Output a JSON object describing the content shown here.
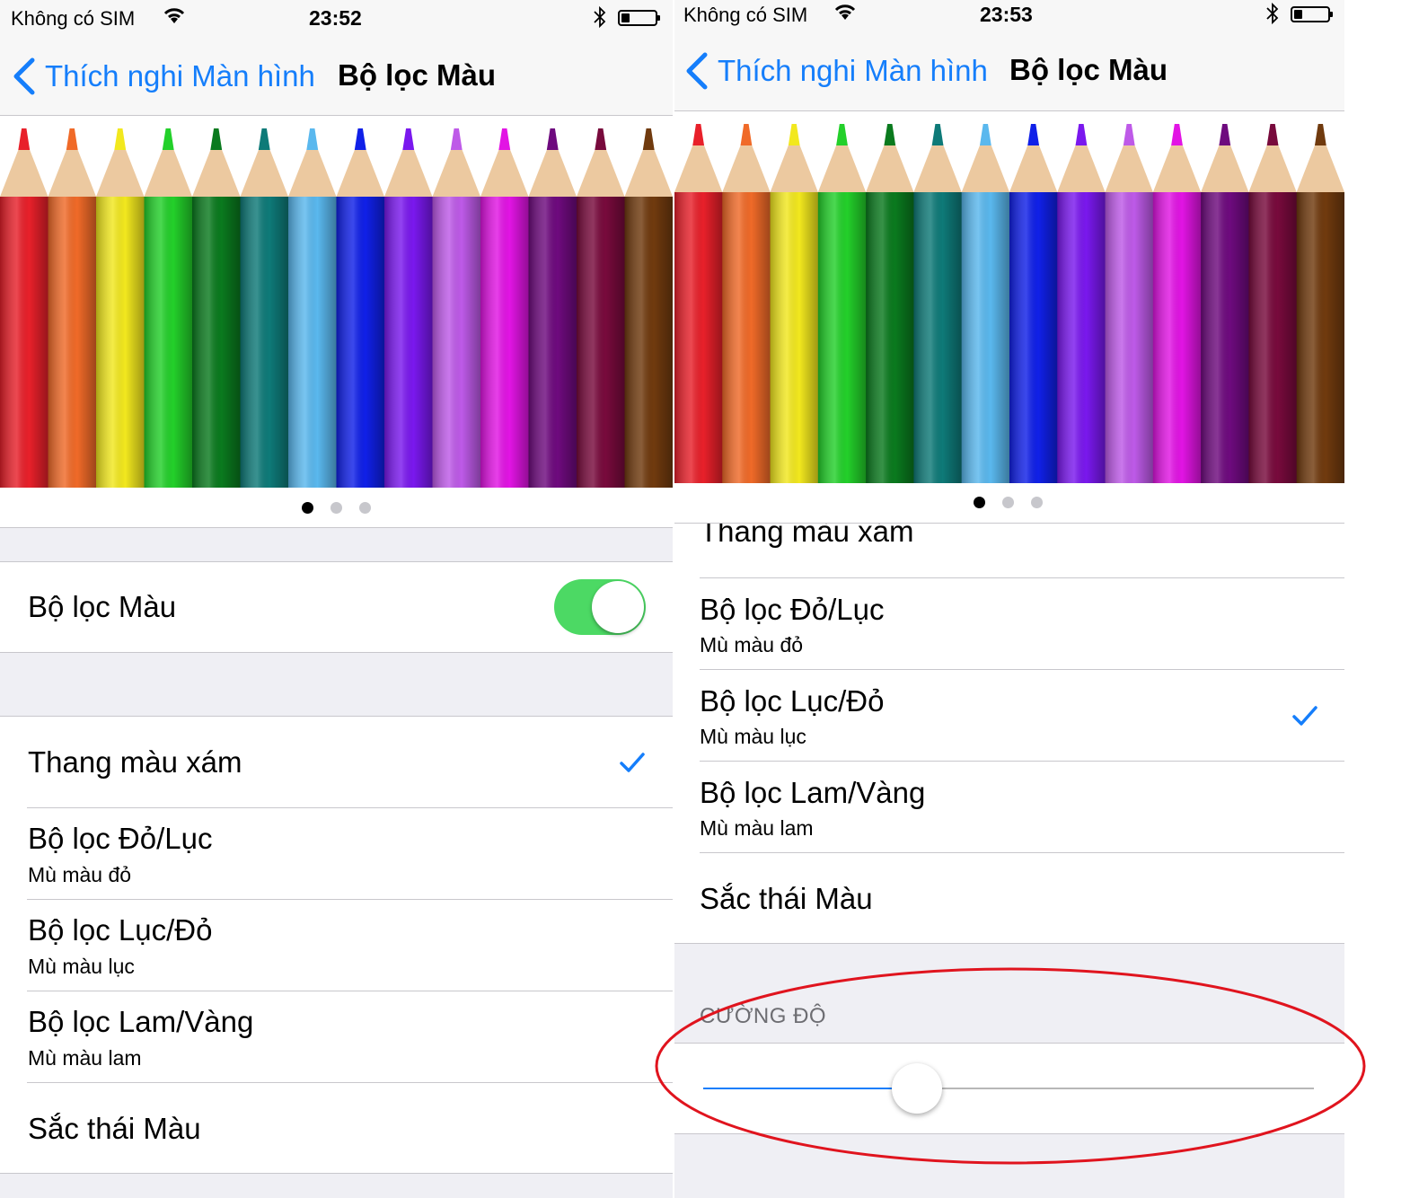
{
  "colors": {
    "accent": "#157efb",
    "switch_on": "#4cd964",
    "annotation": "#e0141e"
  },
  "left": {
    "status": {
      "carrier": "Không có SIM",
      "time": "23:52"
    },
    "nav": {
      "back": "Thích nghi Màn hình",
      "title": "Bộ lọc Màu"
    },
    "pager": {
      "count": 3,
      "active": 1
    },
    "toggle": {
      "label": "Bộ lọc Màu",
      "on": true
    },
    "filters": [
      {
        "title": "Thang màu xám",
        "subtitle": "",
        "checked": true
      },
      {
        "title": "Bộ lọc Đỏ/Lục",
        "subtitle": "Mù màu đỏ",
        "checked": false
      },
      {
        "title": "Bộ lọc Lục/Đỏ",
        "subtitle": "Mù màu lục",
        "checked": false
      },
      {
        "title": "Bộ lọc Lam/Vàng",
        "subtitle": "Mù màu lam",
        "checked": false
      },
      {
        "title": "Sắc thái Màu",
        "subtitle": "",
        "checked": false
      }
    ]
  },
  "right": {
    "status": {
      "carrier": "Không có SIM",
      "time": "23:53"
    },
    "nav": {
      "back": "Thích nghi Màn hình",
      "title": "Bộ lọc Màu"
    },
    "pager": {
      "count": 3,
      "active": 1
    },
    "partial_row": "Thang màu xám",
    "filters": [
      {
        "title": "Bộ lọc Đỏ/Lục",
        "subtitle": "Mù màu đỏ",
        "checked": false
      },
      {
        "title": "Bộ lọc Lục/Đỏ",
        "subtitle": "Mù màu lục",
        "checked": true
      },
      {
        "title": "Bộ lọc Lam/Vàng",
        "subtitle": "Mù màu lam",
        "checked": false
      },
      {
        "title": "Sắc thái Màu",
        "subtitle": "",
        "checked": false
      }
    ],
    "intensity": {
      "header": "CƯỜNG ĐỘ",
      "value": 0.35
    }
  }
}
